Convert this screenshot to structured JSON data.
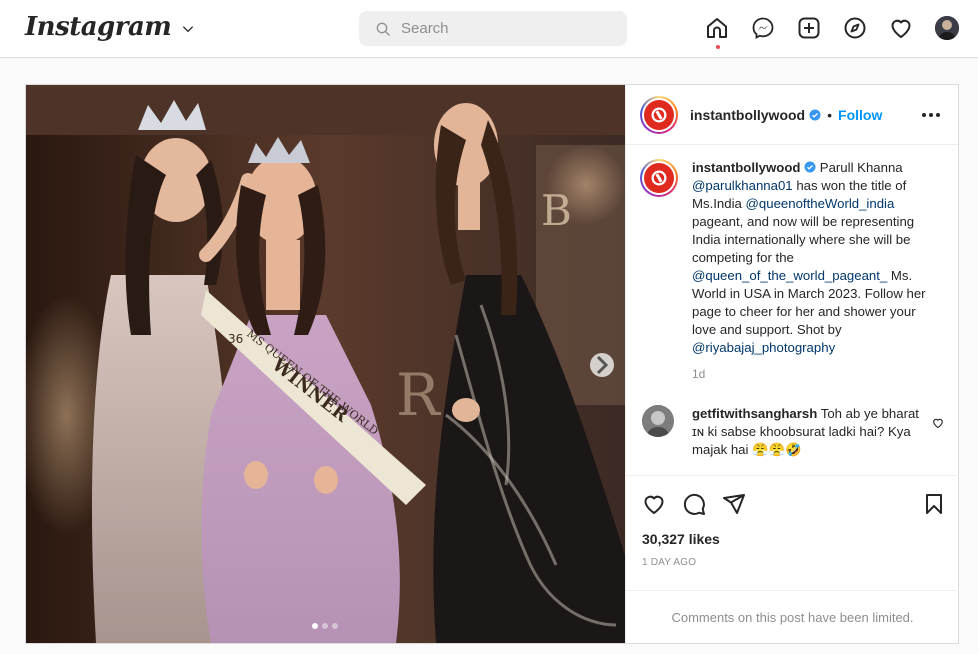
{
  "nav": {
    "logo": "Instagram",
    "search_placeholder": "Search"
  },
  "post": {
    "author": "instantbollywood",
    "follow_label": "Follow",
    "separator": "•",
    "caption": {
      "lead": "Parull Khanna",
      "mention1": "@parulkhanna01",
      "text1": "has won the title of Ms.India",
      "mention2": "@queenoftheWorld_india",
      "text2": "pageant, and now will be representing India internationally where she will be competing for the",
      "mention3": "@queen_of_the_world_pageant_",
      "text3": "Ms. World in USA in March 2023. Follow her page to cheer for her and shower your love and support. Shot by",
      "mention4": "@riyabajaj_photography"
    },
    "caption_time": "1d",
    "comment": {
      "author": "getfitwithsangharsh",
      "text": "Toh ab ye bharat ɪɴ ki sabse khoobsurat ladki hai? Kya majak hai 😤😤🤣"
    },
    "likes": "30,327 likes",
    "posted_ago": "1 DAY AGO",
    "comments_limited": "Comments on this post have been limited.",
    "carousel": {
      "slides": 3,
      "current": 1
    },
    "photo_text": {
      "sash_line1": "MS QUEEN OF THE WORLD",
      "sash_line2": "WINNER",
      "sash_number": "36"
    }
  },
  "icons": {
    "home": "home-icon",
    "messenger": "messenger-icon",
    "new_post": "new-post-icon",
    "explore": "explore-icon",
    "activity": "heart-icon",
    "like": "heart-icon",
    "comment": "comment-icon",
    "share": "share-icon",
    "save": "bookmark-icon"
  },
  "colors": {
    "link": "#0095f6",
    "mention": "#00376b",
    "notification": "#ed4956"
  }
}
